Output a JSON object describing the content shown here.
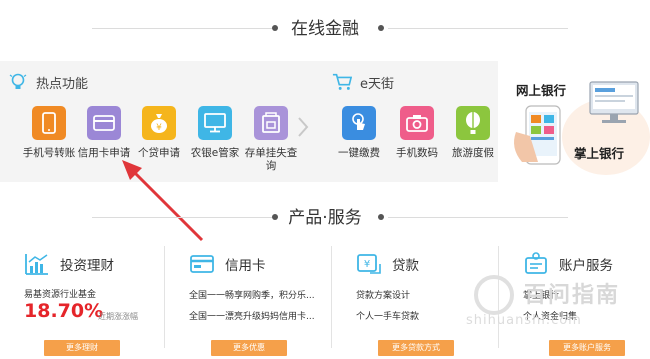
{
  "sections": {
    "online_finance": "在线金融",
    "products_services": "产品·服务"
  },
  "hot": {
    "title": "热点功能",
    "items": [
      {
        "label": "手机号转账",
        "color": "#f08a24",
        "icon": "phone-icon"
      },
      {
        "label": "信用卡申请",
        "color": "#9b87d6",
        "icon": "card-icon"
      },
      {
        "label": "个贷申请",
        "color": "#f5b51c",
        "icon": "money-bag-icon"
      },
      {
        "label": "农银e管家",
        "color": "#3fb6e6",
        "icon": "monitor-icon"
      },
      {
        "label": "存单挂失查询",
        "color": "#a993d9",
        "icon": "document-icon"
      }
    ]
  },
  "etian": {
    "title": "e天街",
    "items": [
      {
        "label": "一键缴费",
        "color": "#3a8de0",
        "icon": "tap-icon"
      },
      {
        "label": "手机数码",
        "color": "#ef5d8a",
        "icon": "camera-icon"
      },
      {
        "label": "旅游度假",
        "color": "#8cc63e",
        "icon": "balloon-icon"
      }
    ]
  },
  "side": {
    "online_bank": "网上银行",
    "mobile_bank": "掌上银行"
  },
  "services": [
    {
      "title": "投资理财",
      "icon": "chart-icon",
      "line1": "易基资源行业基金",
      "rate": "18.70%",
      "rate_note": "近期涨涨幅",
      "button": "更多理财"
    },
    {
      "title": "信用卡",
      "icon": "credit-card-icon",
      "line1": "全国一一畅享网购季，积分乐...",
      "line2": "全国一一漂亮升级妈妈信用卡...",
      "button": "更多优惠"
    },
    {
      "title": "贷款",
      "icon": "loan-icon",
      "line1": "贷款方案设计",
      "line2": "个人一手车贷款",
      "button": "更多贷款方式"
    },
    {
      "title": "账户服务",
      "icon": "account-icon",
      "line1": "掌上银行",
      "line2": "个人资金归集",
      "button": "更多账户服务"
    }
  ],
  "watermark": {
    "text": "百问指南",
    "sub": "shihuanshi.com"
  },
  "colors": {
    "annotation_arrow": "#e0363a",
    "button_orange": "#f5a04a",
    "rate_red": "#e5252a"
  }
}
